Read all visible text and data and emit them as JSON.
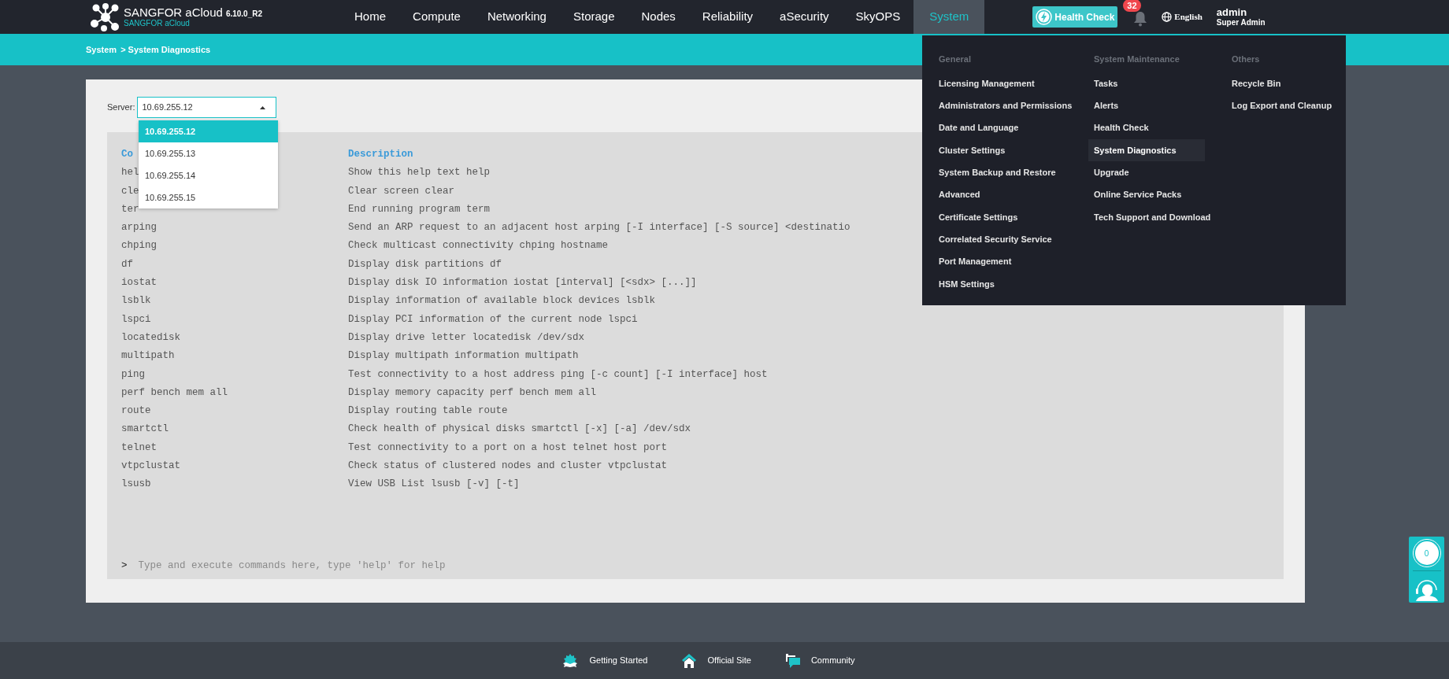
{
  "brand": {
    "name": "SANGFOR aCloud",
    "version": "6.10.0_R2",
    "subtitle": "SANGFOR aCloud"
  },
  "nav": [
    {
      "label": "Home",
      "selected": false
    },
    {
      "label": "Compute",
      "selected": false
    },
    {
      "label": "Networking",
      "selected": false
    },
    {
      "label": "Storage",
      "selected": false
    },
    {
      "label": "Nodes",
      "selected": false
    },
    {
      "label": "Reliability",
      "selected": false
    },
    {
      "label": "aSecurity",
      "selected": false
    },
    {
      "label": "SkyOPS",
      "selected": false
    },
    {
      "label": "System",
      "selected": true
    }
  ],
  "health_check": "Health Check",
  "notifications": "32",
  "language": "English",
  "user": {
    "name": "admin",
    "role": "Super Admin"
  },
  "breadcrumb": [
    "System",
    "> System Diagnostics"
  ],
  "server": {
    "label": "Server:",
    "value": "10.69.255.12",
    "options": [
      {
        "label": "10.69.255.12",
        "selected": true
      },
      {
        "label": "10.69.255.13",
        "selected": false
      },
      {
        "label": "10.69.255.14",
        "selected": false
      },
      {
        "label": "10.69.255.15",
        "selected": false
      }
    ]
  },
  "terminal": {
    "columns": [
      "Co",
      "Description"
    ],
    "rows": [
      [
        "hel",
        "Show this help text help"
      ],
      [
        "cle",
        "Clear screen clear"
      ],
      [
        "ter",
        "End running program term"
      ],
      [
        "arping",
        "Send an ARP request to an adjacent host arping [-I interface] [-S source] <destinatio"
      ],
      [
        "chping",
        "Check multicast connectivity chping hostname"
      ],
      [
        "df",
        "Display disk partitions df"
      ],
      [
        "iostat",
        "Display disk IO information iostat [interval] [<sdx> [...]]"
      ],
      [
        "lsblk",
        "Display information of available block devices lsblk"
      ],
      [
        "lspci",
        "Display PCI information of the current node lspci"
      ],
      [
        "locatedisk",
        "Display drive letter locatedisk /dev/sdx"
      ],
      [
        "multipath",
        "Display multipath information multipath"
      ],
      [
        "ping",
        "Test connectivity to a host address ping [-c count] [-I interface] host"
      ],
      [
        "perf bench mem all",
        "Display memory capacity perf bench mem all"
      ],
      [
        "route",
        "Display routing table route"
      ],
      [
        "smartctl",
        "Check health of physical disks smartctl [-x] [-a] /dev/sdx"
      ],
      [
        "telnet",
        "Test connectivity to a port on a host telnet host port"
      ],
      [
        "vtpclustat",
        "Check status of clustered nodes and cluster vtpclustat"
      ],
      [
        "lsusb",
        "View USB List lsusb [-v] [-t]"
      ]
    ],
    "prompt": ">",
    "placeholder": "Type and execute commands here, type 'help' for help"
  },
  "system_menu": [
    {
      "heading": "General",
      "items": [
        {
          "label": "Licensing Management",
          "selected": false
        },
        {
          "label": "Administrators and Permissions",
          "selected": false
        },
        {
          "label": "Date and Language",
          "selected": false
        },
        {
          "label": "Cluster Settings",
          "selected": false
        },
        {
          "label": "System Backup and Restore",
          "selected": false
        },
        {
          "label": "Advanced",
          "selected": false
        },
        {
          "label": "Certificate Settings",
          "selected": false
        },
        {
          "label": "Correlated Security Service",
          "selected": false
        },
        {
          "label": "Port Management",
          "selected": false
        },
        {
          "label": "HSM Settings",
          "selected": false
        }
      ]
    },
    {
      "heading": "System Maintenance",
      "items": [
        {
          "label": "Tasks",
          "selected": false
        },
        {
          "label": "Alerts",
          "selected": false
        },
        {
          "label": "Health Check",
          "selected": false
        },
        {
          "label": "System Diagnostics",
          "selected": true
        },
        {
          "label": "Upgrade",
          "selected": false
        },
        {
          "label": "Online Service Packs",
          "selected": false
        },
        {
          "label": "Tech Support and Download",
          "selected": false
        }
      ]
    },
    {
      "heading": "Others",
      "items": [
        {
          "label": "Recycle Bin",
          "selected": false
        },
        {
          "label": "Log Export and Cleanup",
          "selected": false
        }
      ]
    }
  ],
  "side_widget": {
    "count": "0"
  },
  "footer": [
    {
      "kind": "start",
      "label": "Getting Started"
    },
    {
      "kind": "site",
      "label": "Official Site"
    },
    {
      "kind": "community",
      "label": "Community"
    }
  ]
}
